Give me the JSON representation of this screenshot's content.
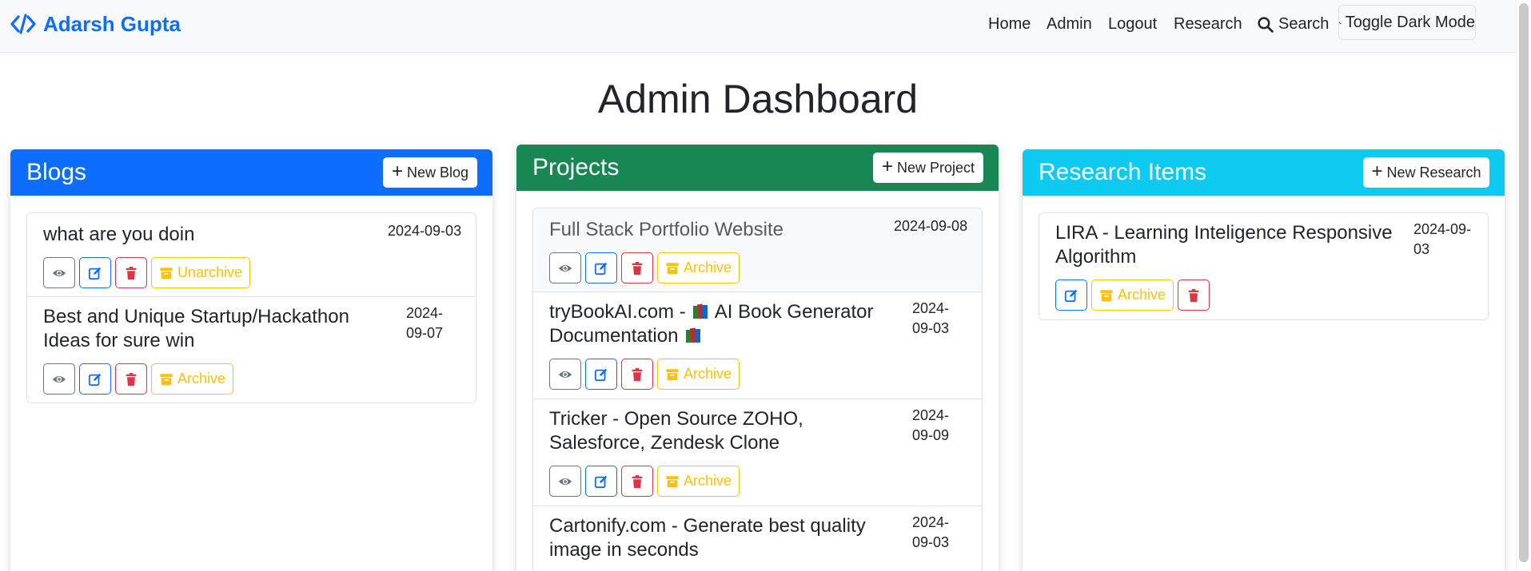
{
  "navbar": {
    "brand": "Adarsh Gupta",
    "links": [
      "Home",
      "Admin",
      "Logout",
      "Research"
    ],
    "search_label": "Search",
    "dark_mode_label": "Toggle Dark Mode"
  },
  "page_title": "Admin Dashboard",
  "colors": {
    "blogs": "#0d6efd",
    "projects": "#198754",
    "research": "#0dcaf0"
  },
  "blogs": {
    "title": "Blogs",
    "new_label": "New Blog",
    "items": [
      {
        "title": "what are you doin",
        "date": "2024-09-03",
        "archive_label": "Unarchive"
      },
      {
        "title": "Best and Unique Startup/Hackathon Ideas for sure win",
        "date": "2024-09-07",
        "archive_label": "Archive"
      }
    ]
  },
  "projects": {
    "title": "Projects",
    "new_label": "New Project",
    "items": [
      {
        "title": "Full Stack Portfolio Website",
        "date": "2024-09-08",
        "archive_label": "Archive"
      },
      {
        "title_a": "tryBookAI.com - ",
        "title_b": " AI Book Generator Documentation ",
        "date": "2024-09-03",
        "archive_label": "Archive"
      },
      {
        "title": "Tricker - Open Source ZOHO, Salesforce, Zendesk Clone",
        "date": "2024-09-09",
        "archive_label": "Archive"
      },
      {
        "title": "Cartonify.com - Generate best quality image in seconds",
        "date": "2024-09-03"
      }
    ]
  },
  "research": {
    "title": "Research Items",
    "new_label": "New Research",
    "items": [
      {
        "title": "LIRA - Learning Inteligence Responsive Algorithm",
        "date": "2024-09-03",
        "archive_label": "Archive"
      }
    ]
  }
}
